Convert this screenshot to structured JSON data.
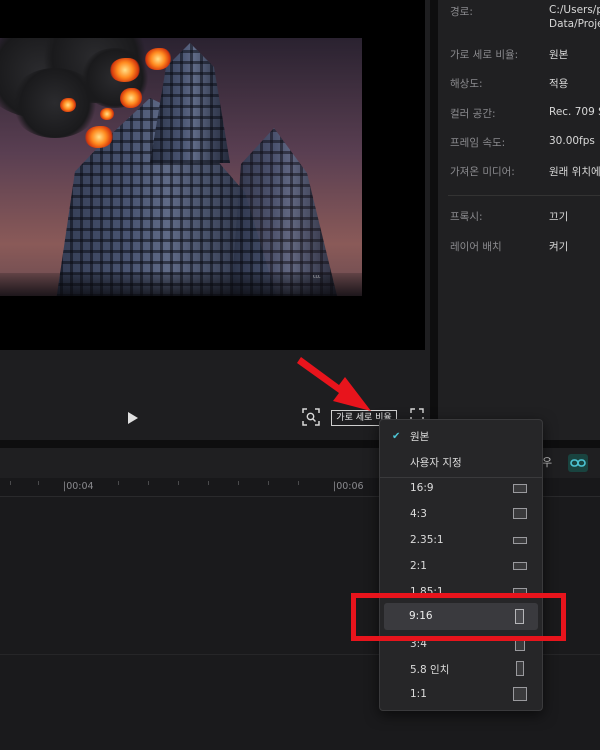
{
  "preview": {
    "overlay_text": "ᴸᴸᴸ",
    "ratio_button_label": "가로 세로 비율"
  },
  "properties": {
    "rows": [
      {
        "label": "경로:",
        "value": "C:/Users/p",
        "value2": "Data/Proje"
      },
      {
        "label": "가로 세로 비율:",
        "value": "원본"
      },
      {
        "label": "해상도:",
        "value": "적용"
      },
      {
        "label": "컬러 공간:",
        "value": "Rec. 709 S"
      },
      {
        "label": "프레임 속도:",
        "value": "30.00fps"
      },
      {
        "label": "가져온 미디어:",
        "value": "원래 위치에"
      }
    ],
    "rows2": [
      {
        "label": "프록시:",
        "value": "끄기"
      },
      {
        "label": "레이어 배치",
        "value": "켜기"
      }
    ]
  },
  "timeline": {
    "timecodes": [
      "|00:04",
      "|00:06"
    ],
    "toolbar_glyph": "우"
  },
  "dropdown": {
    "check_glyph": "✔",
    "top_items": [
      "원본",
      "사용자 지정"
    ],
    "ratios": [
      "16:9",
      "4:3",
      "2.35:1",
      "2:1",
      "1.85:1",
      "9:16",
      "3:4",
      "5.8 인치",
      "1:1"
    ],
    "selected": "9:16"
  },
  "colors": {
    "highlight": "#e8141c",
    "accent": "#4dc4d4"
  }
}
